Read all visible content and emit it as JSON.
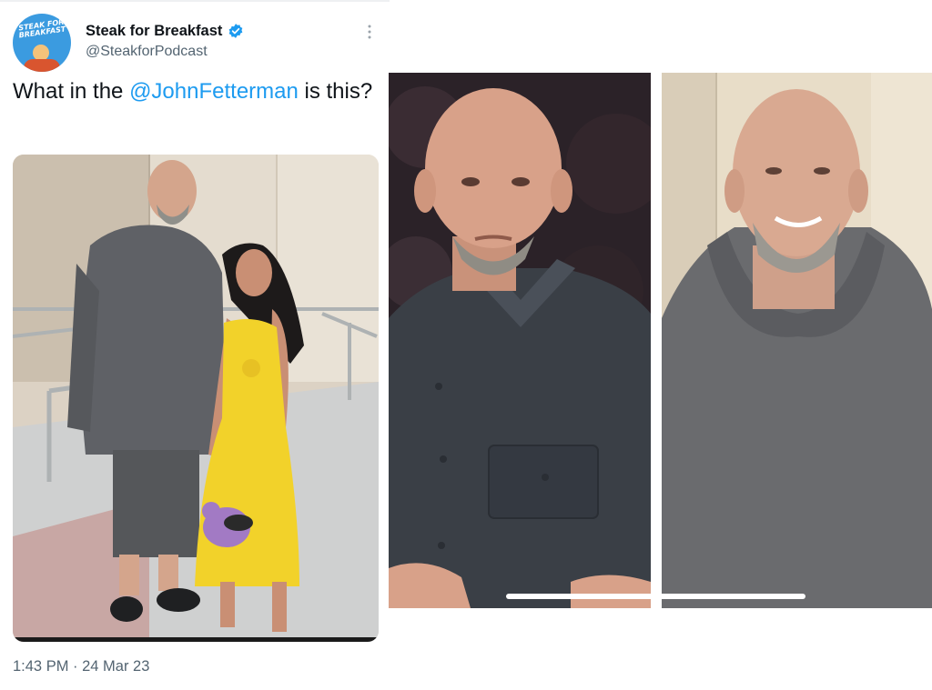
{
  "tweet": {
    "display_name": "Steak for Breakfast",
    "handle": "@SteakforPodcast",
    "text_before": "What in the ",
    "mention": "@JohnFetterman",
    "text_after": " is this?",
    "timestamp": "1:43 PM · 24 Mar 23",
    "avatar_text": "STEAK FOR BREAKFAST"
  },
  "icons": {
    "verified": "verified-badge-icon",
    "more": "more-options-icon"
  },
  "colors": {
    "link": "#1d9bf0",
    "text": "#0f1419",
    "secondary": "#536471",
    "dress": "#f2d22a",
    "hoodie": "#5f6166",
    "shirt": "#3a3f46"
  }
}
